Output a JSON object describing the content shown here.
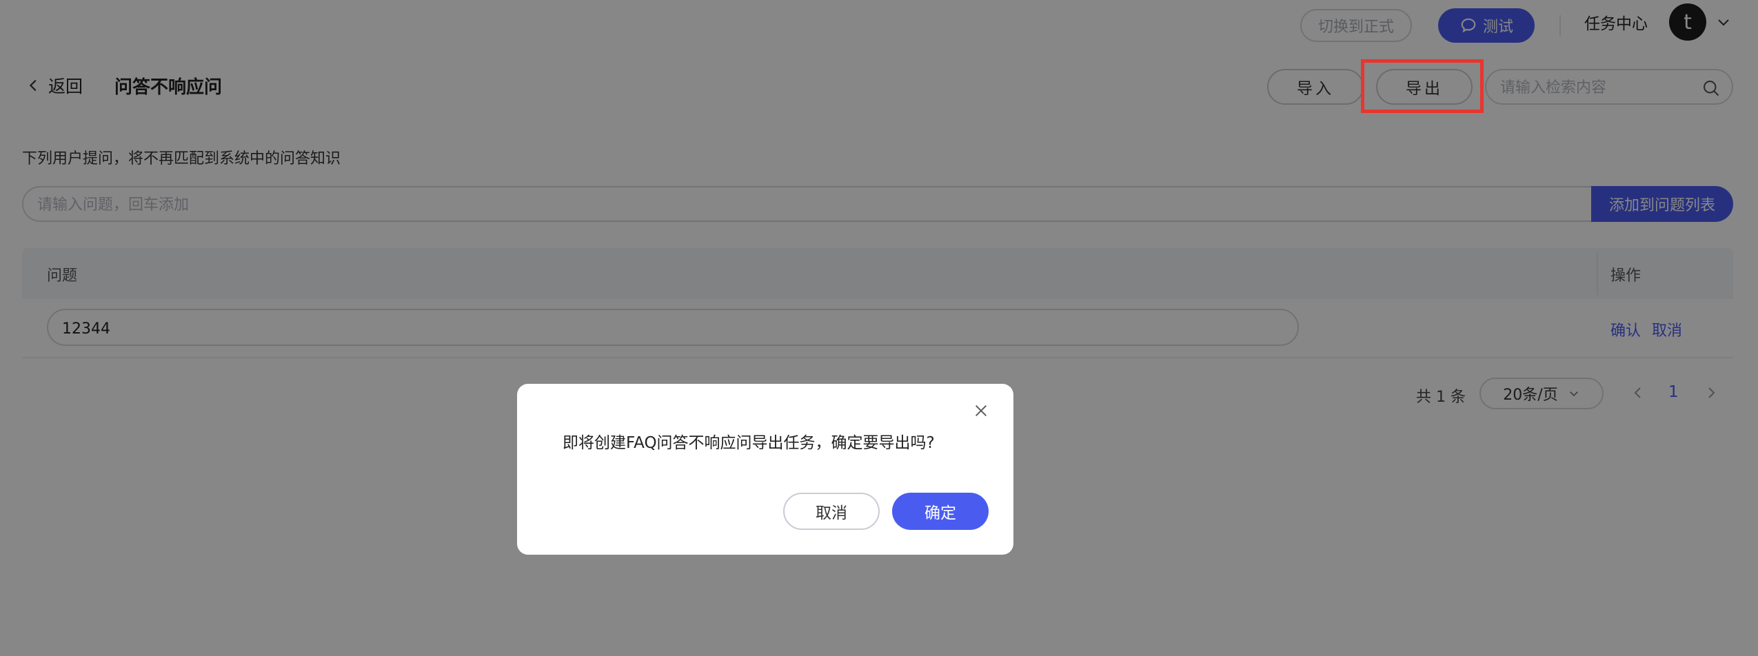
{
  "topbar": {
    "switch_label": "切换到正式",
    "test_label": "测试",
    "test_icon": "chat-bubble-icon",
    "task_center": "任务中心",
    "avatar_letter": "t"
  },
  "header": {
    "back_label": "返回",
    "title": "问答不响应问",
    "import_label": "导入",
    "export_label": "导出",
    "search_placeholder": "请输入检索内容"
  },
  "content": {
    "description": "下列用户提问，将不再匹配到系统中的问答知识",
    "add_placeholder": "请输入问题，回车添加",
    "add_button": "添加到问题列表",
    "table": {
      "columns": [
        "问题",
        "操作"
      ],
      "rows": [
        {
          "question": "12344",
          "actions": [
            "确认",
            "取消"
          ]
        }
      ]
    },
    "pagination": {
      "total": "共 1 条",
      "page_size": "20条/页",
      "current_page": "1"
    }
  },
  "modal": {
    "message": "即将创建FAQ问答不响应问导出任务，确定要导出吗?",
    "cancel_label": "取消",
    "confirm_label": "确定"
  },
  "colors": {
    "accent": "#4a5cf0",
    "highlight": "#e8362e",
    "overlay": "rgba(0,0,0,0.47)"
  }
}
